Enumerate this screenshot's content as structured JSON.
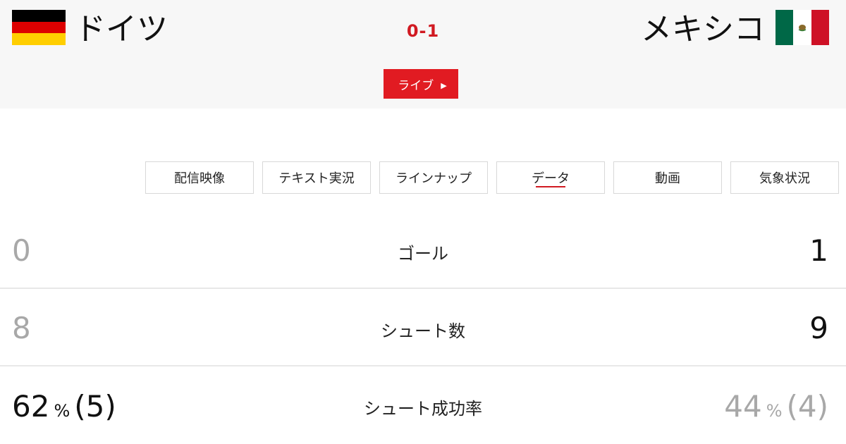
{
  "match": {
    "home_team": "ドイツ",
    "away_team": "メキシコ",
    "score": "0-1",
    "live_label": "ライブ",
    "home_flag_colors": [
      "#000000",
      "#dd0000",
      "#ffce00"
    ],
    "away_flag_colors": [
      "#006847",
      "#ffffff",
      "#ce1126"
    ]
  },
  "tabs": [
    {
      "label": "配信映像",
      "active": false
    },
    {
      "label": "テキスト実況",
      "active": false
    },
    {
      "label": "ラインナップ",
      "active": false
    },
    {
      "label": "データ",
      "active": true
    },
    {
      "label": "動画",
      "active": false
    },
    {
      "label": "気象状況",
      "active": false
    }
  ],
  "stats": [
    {
      "label": "ゴール",
      "home": "0",
      "away": "1"
    },
    {
      "label": "シュート数",
      "home": "8",
      "away": "9"
    },
    {
      "label": "シュート成功率",
      "home_value": "62",
      "home_unit": "%",
      "home_extra": "(5)",
      "away_value": "44",
      "away_unit": "%",
      "away_extra": "(4)"
    }
  ],
  "colors": {
    "accent": "#e11b22",
    "score": "#d11a22",
    "header_bg": "#f7f7f7",
    "dim_value": "#a8a8a8"
  }
}
